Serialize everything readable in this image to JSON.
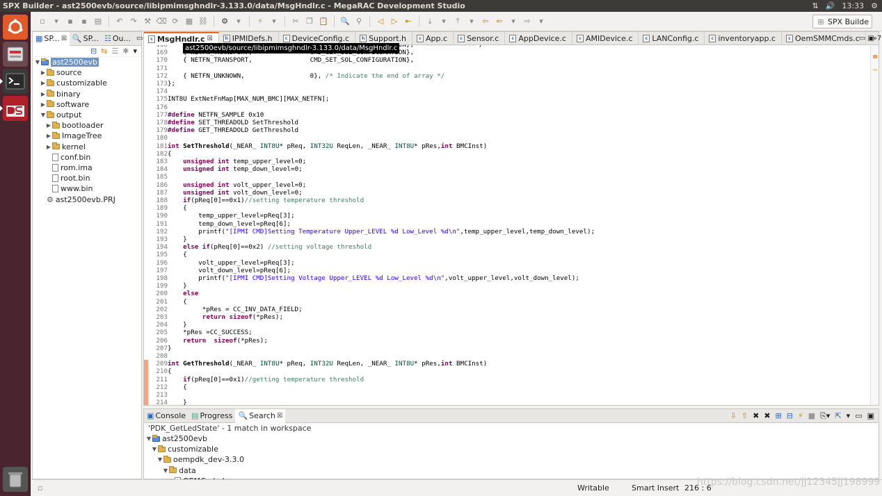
{
  "window": {
    "title": "SPX Builder - ast2500evb/source/libipmimsghndlr-3.133.0/data/MsgHndlr.c - MegaRAC Development Studio",
    "time": "13:33"
  },
  "perspective": {
    "label": "SPX Builde"
  },
  "left_panel": {
    "tabs": [
      "SP...",
      "SP...",
      "Ou..."
    ],
    "tree": [
      {
        "label": "ast2500evb",
        "level": 0,
        "kind": "project",
        "open": true,
        "selected": true
      },
      {
        "label": "source",
        "level": 1,
        "kind": "folder"
      },
      {
        "label": "customizable",
        "level": 1,
        "kind": "folder"
      },
      {
        "label": "binary",
        "level": 1,
        "kind": "folder"
      },
      {
        "label": "software",
        "level": 1,
        "kind": "folder"
      },
      {
        "label": "output",
        "level": 1,
        "kind": "folder",
        "open": true
      },
      {
        "label": "bootloader",
        "level": 2,
        "kind": "folder"
      },
      {
        "label": "ImageTree",
        "level": 2,
        "kind": "folder"
      },
      {
        "label": "kernel",
        "level": 2,
        "kind": "folder"
      },
      {
        "label": "conf.bin",
        "level": 2,
        "kind": "file"
      },
      {
        "label": "rom.ima",
        "level": 2,
        "kind": "file"
      },
      {
        "label": "root.bin",
        "level": 2,
        "kind": "file"
      },
      {
        "label": "www.bin",
        "level": 2,
        "kind": "file"
      },
      {
        "label": "ast2500evb.PRJ",
        "level": 1,
        "kind": "prj"
      }
    ]
  },
  "editor": {
    "tabs": [
      "MsgHndlr.c",
      "IPMIDefs.h",
      "DeviceConfig.c",
      "Support.h",
      "App.c",
      "Sensor.c",
      "AppDevice.c",
      "AMIDevice.c",
      "LANConfig.c",
      "inventoryapp.c",
      "OemSMMCmds.c"
    ],
    "overflow_label": "»7",
    "tooltip": "ast2500evb/source/libipmimsghndlr-3.133.0/data/MsgHndlr.c",
    "lines": [
      {
        "n": "168",
        "segs": [
          [
            "",
            "    { NETFN_TRANSPORT,               CMD_SET_SOL_CONFIGURATION},   -------------*/"
          ]
        ]
      },
      {
        "n": "169",
        "segs": [
          [
            "",
            "    { NETFN_TRANSPORT,               CMD_GET_SOL_CONFIGURATION},"
          ]
        ]
      },
      {
        "n": "170",
        "segs": [
          [
            "",
            "    { NETFN_TRANSPORT,               CMD_SET_SOL_CONFIGURATION},"
          ]
        ]
      },
      {
        "n": "171",
        "segs": [
          [
            "",
            ""
          ]
        ]
      },
      {
        "n": "172",
        "segs": [
          [
            "",
            "    { NETFN_UNKNOWN,                 0}, "
          ],
          [
            "cm",
            "/* Indicate the end of array */"
          ]
        ]
      },
      {
        "n": "173",
        "segs": [
          [
            "",
            "};"
          ]
        ]
      },
      {
        "n": "174",
        "segs": [
          [
            "",
            ""
          ]
        ]
      },
      {
        "n": "175",
        "segs": [
          [
            "",
            "INT8U ExtNetFnMap[MAX_NUM_BMC][MAX_NETFN];"
          ]
        ]
      },
      {
        "n": "176",
        "segs": [
          [
            "",
            ""
          ]
        ]
      },
      {
        "n": "177",
        "segs": [
          [
            "pp",
            "#define"
          ],
          [
            "",
            " NETFN_SAMPLE 0x10"
          ]
        ]
      },
      {
        "n": "178",
        "segs": [
          [
            "pp",
            "#define"
          ],
          [
            "",
            " SET_THREADOLD SetThreshold"
          ]
        ]
      },
      {
        "n": "179",
        "segs": [
          [
            "pp",
            "#define"
          ],
          [
            "",
            " GET_THREADOLD GetThreshold"
          ]
        ]
      },
      {
        "n": "180",
        "segs": [
          [
            "",
            ""
          ]
        ]
      },
      {
        "n": "181",
        "segs": [
          [
            "kw",
            "int"
          ],
          [
            "",
            " "
          ],
          [
            "fn",
            "SetThreshold"
          ],
          [
            "",
            "(_NEAR_ "
          ],
          [
            "ty",
            "INT8U"
          ],
          [
            "",
            "* pReq, "
          ],
          [
            "ty",
            "INT32U"
          ],
          [
            "",
            " ReqLen, _NEAR_ "
          ],
          [
            "ty",
            "INT8U"
          ],
          [
            "",
            "* pRes,"
          ],
          [
            "kw",
            "int"
          ],
          [
            "",
            " BMCInst)"
          ]
        ]
      },
      {
        "n": "182",
        "segs": [
          [
            "",
            "{"
          ]
        ]
      },
      {
        "n": "183",
        "segs": [
          [
            "",
            "    "
          ],
          [
            "kw",
            "unsigned int"
          ],
          [
            "",
            " temp_upper_level=0;"
          ]
        ]
      },
      {
        "n": "184",
        "segs": [
          [
            "",
            "    "
          ],
          [
            "kw",
            "unsigned int"
          ],
          [
            "",
            " temp_down_level=0;"
          ]
        ]
      },
      {
        "n": "185",
        "segs": [
          [
            "",
            ""
          ]
        ]
      },
      {
        "n": "186",
        "segs": [
          [
            "",
            "    "
          ],
          [
            "kw",
            "unsigned int"
          ],
          [
            "",
            " volt_upper_level=0;"
          ]
        ]
      },
      {
        "n": "187",
        "segs": [
          [
            "",
            "    "
          ],
          [
            "kw",
            "unsigned int"
          ],
          [
            "",
            " volt_down_level=0;"
          ]
        ]
      },
      {
        "n": "188",
        "segs": [
          [
            "",
            "    "
          ],
          [
            "kw",
            "if"
          ],
          [
            "",
            "(pReq[0]==0x1)"
          ],
          [
            "cm",
            "//setting temperature threshold"
          ]
        ]
      },
      {
        "n": "189",
        "segs": [
          [
            "",
            "    {"
          ]
        ]
      },
      {
        "n": "190",
        "segs": [
          [
            "",
            "        temp_upper_level=pReq[3];"
          ]
        ]
      },
      {
        "n": "191",
        "segs": [
          [
            "",
            "        temp_down_level=pReq[6];"
          ]
        ]
      },
      {
        "n": "192",
        "segs": [
          [
            "",
            "        printf("
          ],
          [
            "st",
            "\"[IPMI CMD]Setting Temperature Upper_LEVEL %d Low_Level %d\\n\""
          ],
          [
            "",
            ",temp_upper_level,temp_down_level);"
          ]
        ]
      },
      {
        "n": "193",
        "segs": [
          [
            "",
            "    }"
          ]
        ]
      },
      {
        "n": "194",
        "segs": [
          [
            "",
            "    "
          ],
          [
            "kw",
            "else if"
          ],
          [
            "",
            "(pReq[0]==0x2) "
          ],
          [
            "cm",
            "//setting voltage threshold"
          ]
        ]
      },
      {
        "n": "195",
        "segs": [
          [
            "",
            "    {"
          ]
        ]
      },
      {
        "n": "196",
        "segs": [
          [
            "",
            "        volt_upper_level=pReq[3];"
          ]
        ]
      },
      {
        "n": "197",
        "segs": [
          [
            "",
            "        volt_down_level=pReq[6];"
          ]
        ]
      },
      {
        "n": "198",
        "segs": [
          [
            "",
            "        printf("
          ],
          [
            "st",
            "\"[IPMI CMD]Setting Voltage Upper_LEVEL %d Low_Level %d\\n\""
          ],
          [
            "",
            ",volt_upper_level,volt_down_level);"
          ]
        ]
      },
      {
        "n": "199",
        "segs": [
          [
            "",
            "    }"
          ]
        ]
      },
      {
        "n": "200",
        "segs": [
          [
            "",
            "    "
          ],
          [
            "kw",
            "else"
          ]
        ]
      },
      {
        "n": "201",
        "segs": [
          [
            "",
            "    {"
          ]
        ]
      },
      {
        "n": "202",
        "segs": [
          [
            "",
            "         *pRes = CC_INV_DATA_FIELD;"
          ]
        ]
      },
      {
        "n": "203",
        "segs": [
          [
            "",
            "         "
          ],
          [
            "kw",
            "return sizeof"
          ],
          [
            "",
            "(*pRes);"
          ]
        ]
      },
      {
        "n": "204",
        "segs": [
          [
            "",
            "    }"
          ]
        ]
      },
      {
        "n": "205",
        "segs": [
          [
            "",
            "    *pRes =CC_SUCCESS;"
          ]
        ]
      },
      {
        "n": "206",
        "segs": [
          [
            "",
            "    "
          ],
          [
            "kw",
            "return  sizeof"
          ],
          [
            "",
            "(*pRes);"
          ]
        ]
      },
      {
        "n": "207",
        "segs": [
          [
            "",
            "}"
          ]
        ]
      },
      {
        "n": "208",
        "segs": [
          [
            "",
            ""
          ]
        ]
      },
      {
        "n": "209",
        "segs": [
          [
            "kw",
            "int"
          ],
          [
            "",
            " "
          ],
          [
            "fn",
            "GetThreshold"
          ],
          [
            "",
            "(_NEAR_ "
          ],
          [
            "ty",
            "INT8U"
          ],
          [
            "",
            "* pReq, "
          ],
          [
            "ty",
            "INT32U"
          ],
          [
            "",
            " ReqLen, _NEAR_ "
          ],
          [
            "ty",
            "INT8U"
          ],
          [
            "",
            "* pRes,"
          ],
          [
            "kw",
            "int"
          ],
          [
            "",
            " BMCInst)"
          ]
        ]
      },
      {
        "n": "210",
        "segs": [
          [
            "",
            "{"
          ]
        ]
      },
      {
        "n": "211",
        "segs": [
          [
            "",
            "    "
          ],
          [
            "kw",
            "if"
          ],
          [
            "",
            "(pReq[0]==0x1)"
          ],
          [
            "cm",
            "//getting temperature threshold"
          ]
        ]
      },
      {
        "n": "212",
        "segs": [
          [
            "",
            "    {"
          ]
        ]
      },
      {
        "n": "213",
        "segs": [
          [
            "",
            ""
          ]
        ]
      },
      {
        "n": "214",
        "segs": [
          [
            "",
            "    }"
          ]
        ]
      }
    ]
  },
  "bottom_panel": {
    "tabs": [
      "Console",
      "Progress",
      "Search"
    ],
    "summary": "'PDK_GetLedState' - 1 match in workspace",
    "tree": [
      {
        "label": "ast2500evb",
        "level": 0,
        "kind": "project"
      },
      {
        "label": "customizable",
        "level": 1,
        "kind": "folder"
      },
      {
        "label": "oempdk_dev-3.3.0",
        "level": 2,
        "kind": "folder"
      },
      {
        "label": "data",
        "level": 3,
        "kind": "folder"
      },
      {
        "label": "OEMCode.h",
        "level": 4,
        "kind": "file"
      }
    ]
  },
  "status": {
    "writable": "Writable",
    "insert_mode": "Smart Insert",
    "position": "216 : 6"
  },
  "watermark": "https://blog.csdn.net/jj12345jj198999",
  "colors": {
    "accent": "#e96a1f",
    "launcher": "#4a2530",
    "topbar": "#3c3b37"
  }
}
